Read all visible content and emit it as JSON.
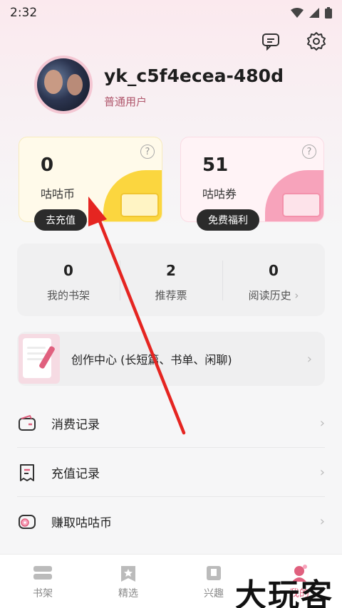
{
  "status_bar": {
    "time": "2:32"
  },
  "profile": {
    "username": "yk_c5f4ecea-480d",
    "level": "普通用户"
  },
  "wallet": {
    "coin": {
      "value": "0",
      "label": "咕咕币",
      "button": "去充值"
    },
    "ticket": {
      "value": "51",
      "label": "咕咕券",
      "button": "免费福利"
    }
  },
  "stats": [
    {
      "value": "0",
      "label": "我的书架"
    },
    {
      "value": "2",
      "label": "推荐票"
    },
    {
      "value": "0",
      "label": "阅读历史"
    }
  ],
  "create_center": {
    "label": "创作中心 (长短篇、书单、闲聊)"
  },
  "menu": [
    {
      "label": "消费记录",
      "icon": "wallet-icon"
    },
    {
      "label": "充值记录",
      "icon": "receipt-icon"
    },
    {
      "label": "赚取咕咕币",
      "icon": "coin-earn-icon"
    }
  ],
  "tabs": [
    {
      "label": "书架",
      "icon": "bookshelf-icon"
    },
    {
      "label": "精选",
      "icon": "featured-icon"
    },
    {
      "label": "兴趣",
      "icon": "interest-icon"
    },
    {
      "label": "我的",
      "icon": "profile-icon"
    }
  ],
  "watermark": "大玩客",
  "colors": {
    "accent": "#e0607e",
    "annotation_arrow": "#e52521"
  }
}
